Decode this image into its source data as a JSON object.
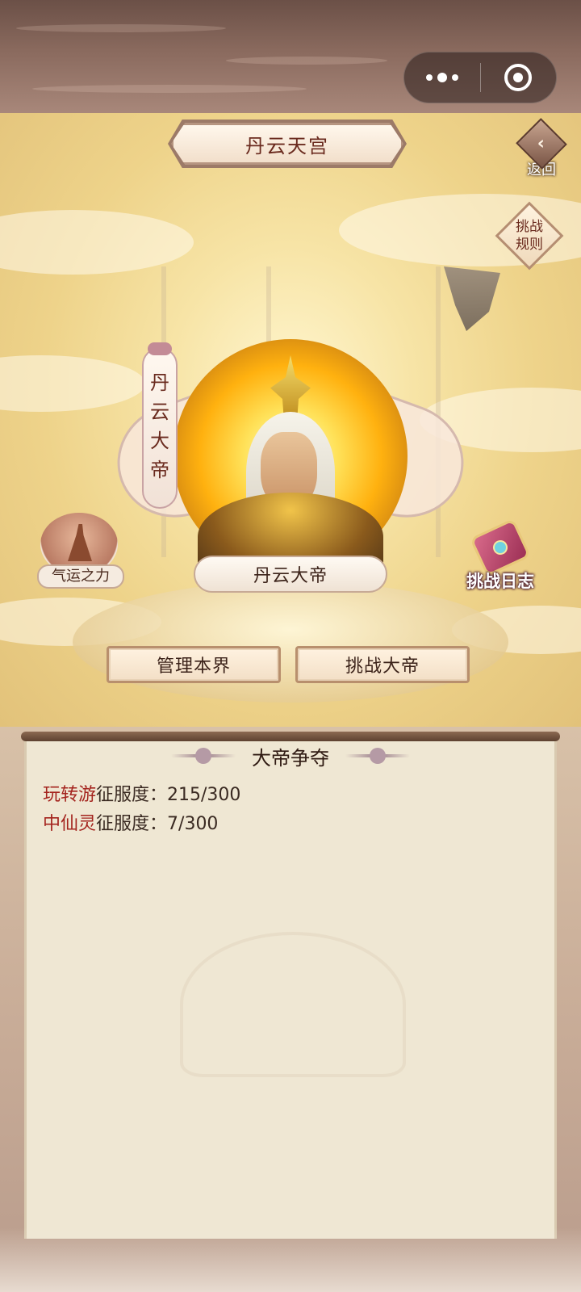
{
  "title": "丹云天宫",
  "back_label": "返回",
  "rules_label_line1": "挑战",
  "rules_label_line2": "规则",
  "emperor": {
    "vertical_name": [
      "丹",
      "云",
      "大",
      "帝"
    ],
    "nameplate": "丹云大帝"
  },
  "fortune_label": "气运之力",
  "log_label": "挑战日志",
  "buttons": {
    "manage": "管理本界",
    "challenge": "挑战大帝"
  },
  "panel": {
    "title": "大帝争夺",
    "stats": [
      {
        "name": "玩转游",
        "label": "征服度：",
        "value": "215/300"
      },
      {
        "name": "中仙灵",
        "label": "征服度：",
        "value": "7/300"
      }
    ]
  }
}
